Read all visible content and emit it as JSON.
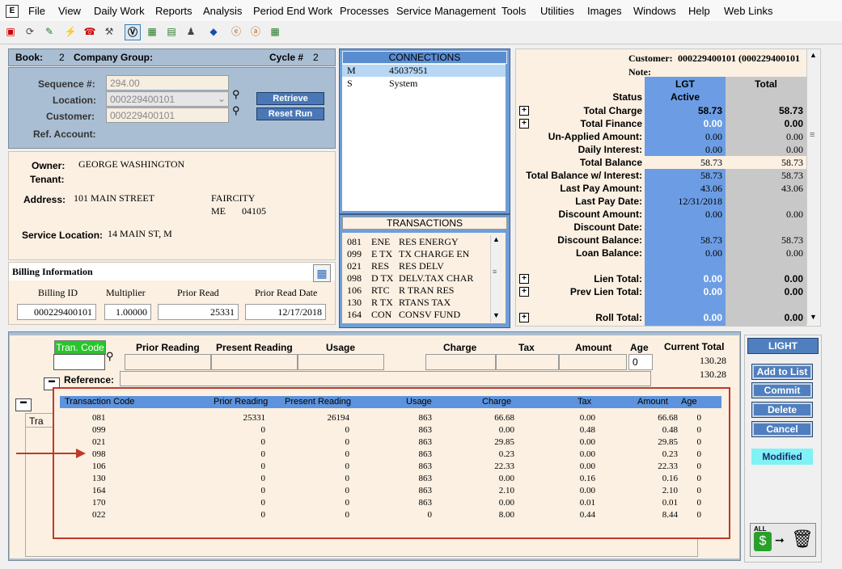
{
  "menu": [
    "File",
    "View",
    "Daily Work",
    "Reports",
    "Analysis",
    "Period End Work",
    "Processes",
    "Service Management",
    "Tools",
    "Utilities",
    "Images",
    "Windows",
    "Help",
    "Web Links"
  ],
  "app_icon_letter": "E",
  "header": {
    "book_label": "Book:",
    "book_value": "2",
    "company_group_label": "Company Group:",
    "cycle_label": "Cycle #",
    "cycle_value": "2"
  },
  "lookup": {
    "sequence_label": "Sequence #:",
    "sequence_value": "294.00",
    "location_label": "Location:",
    "location_value": "000229400101",
    "customer_label": "Customer:",
    "customer_value": "000229400101",
    "ref_account_label": "Ref. Account:",
    "retrieve_label": "Retrieve",
    "reset_run_label": "Reset Run"
  },
  "owner": {
    "owner_label": "Owner:",
    "owner_value": "GEORGE WASHINGTON",
    "tenant_label": "Tenant:",
    "address_label": "Address:",
    "address_value": "101 MAIN STREET",
    "city": "FAIRCITY",
    "state": "ME",
    "zip": "04105",
    "service_location_label": "Service Location:",
    "service_location_value": "14 MAIN ST, M"
  },
  "billing": {
    "title": "Billing Information",
    "billing_id_label": "Billing ID",
    "billing_id_value": "000229400101",
    "multiplier_label": "Multiplier",
    "multiplier_value": "1.00000",
    "prior_read_label": "Prior Read",
    "prior_read_value": "25331",
    "prior_read_date_label": "Prior Read Date",
    "prior_read_date_value": "12/17/2018"
  },
  "connections": {
    "title": "CONNECTIONS",
    "rows": [
      {
        "code": "M",
        "value": "45037951"
      },
      {
        "code": "S",
        "value": "System"
      }
    ]
  },
  "transactions": {
    "title": "TRANSACTIONS",
    "rows": [
      {
        "num": "081",
        "code": "ENE",
        "desc": "RES ENERGY"
      },
      {
        "num": "099",
        "code": "E TX",
        "desc": "TX CHARGE EN"
      },
      {
        "num": "021",
        "code": "RES",
        "desc": "RES DELV"
      },
      {
        "num": "098",
        "code": "D TX",
        "desc": "DELV.TAX CHAR"
      },
      {
        "num": "106",
        "code": "RTC",
        "desc": "R TRAN RES"
      },
      {
        "num": "130",
        "code": "R TX",
        "desc": "RTANS TAX"
      },
      {
        "num": "164",
        "code": "CON",
        "desc": "CONSV FUND"
      }
    ]
  },
  "account": {
    "customer_label": "Customer:",
    "customer_value": "000229400101 (000229400101",
    "note_label": "Note:",
    "col1_header": "LGT",
    "col2_header": "Total",
    "status_label": "Status",
    "status_value": "Active",
    "rows": [
      {
        "label": "Total Charge",
        "lgt": "58.73",
        "total": "58.73",
        "plus": true,
        "bold": true
      },
      {
        "label": "Total Finance",
        "lgt": "0.00",
        "total": "0.00",
        "plus": true,
        "bold": true
      },
      {
        "label": "Un-Applied Amount:",
        "lgt": "0.00",
        "total": "0.00",
        "plus": false,
        "bold": false
      },
      {
        "label": "Daily Interest:",
        "lgt": "0.00",
        "total": "0.00",
        "plus": false,
        "bold": false
      },
      {
        "label": "Total Balance",
        "lgt": "58.73",
        "total": "58.73",
        "plus": false,
        "bold": false,
        "cream": true
      },
      {
        "label": "Total Balance w/ Interest:",
        "lgt": "58.73",
        "total": "58.73",
        "plus": false,
        "bold": false
      },
      {
        "label": "Last Pay Amount:",
        "lgt": "43.06",
        "total": "43.06",
        "plus": false,
        "bold": false
      },
      {
        "label": "Last Pay Date:",
        "lgt": "12/31/2018",
        "total": "",
        "plus": false,
        "bold": false
      },
      {
        "label": "Discount Amount:",
        "lgt": "0.00",
        "total": "0.00",
        "plus": false,
        "bold": false
      },
      {
        "label": "Discount Date:",
        "lgt": "",
        "total": "",
        "plus": false,
        "bold": false
      },
      {
        "label": "Discount Balance:",
        "lgt": "58.73",
        "total": "58.73",
        "plus": false,
        "bold": false
      },
      {
        "label": "Loan Balance:",
        "lgt": "0.00",
        "total": "0.00",
        "plus": false,
        "bold": false
      },
      {
        "label": "",
        "lgt": "",
        "total": "",
        "plus": false,
        "bold": false
      },
      {
        "label": "Lien Total:",
        "lgt": "0.00",
        "total": "0.00",
        "plus": true,
        "bold": true
      },
      {
        "label": "Prev Lien Total:",
        "lgt": "0.00",
        "total": "0.00",
        "plus": true,
        "bold": true
      },
      {
        "label": "",
        "lgt": "",
        "total": "",
        "plus": false,
        "bold": false
      },
      {
        "label": "Roll Total:",
        "lgt": "0.00",
        "total": "0.00",
        "plus": true,
        "bold": true
      }
    ]
  },
  "entry": {
    "tran_code_label": "Tran. Code",
    "prior_reading_label": "Prior Reading",
    "present_reading_label": "Present Reading",
    "usage_label": "Usage",
    "charge_label": "Charge",
    "tax_label": "Tax",
    "amount_label": "Amount",
    "age_label": "Age",
    "age_value": "0",
    "current_total_label": "Current Total",
    "current_total_1": "130.28",
    "current_total_2": "130.28",
    "reference_label": "Reference:",
    "partial_tab_label": "Tra"
  },
  "grid": {
    "headers": [
      "Transaction Code",
      "Prior Reading",
      "Present Reading",
      "Usage",
      "Charge",
      "Tax",
      "Amount",
      "Age"
    ],
    "rows": [
      [
        "081",
        "25331",
        "26194",
        "863",
        "66.68",
        "0.00",
        "66.68",
        "0"
      ],
      [
        "099",
        "0",
        "0",
        "863",
        "0.00",
        "0.48",
        "0.48",
        "0"
      ],
      [
        "021",
        "0",
        "0",
        "863",
        "29.85",
        "0.00",
        "29.85",
        "0"
      ],
      [
        "098",
        "0",
        "0",
        "863",
        "0.23",
        "0.00",
        "0.23",
        "0"
      ],
      [
        "106",
        "0",
        "0",
        "863",
        "22.33",
        "0.00",
        "22.33",
        "0"
      ],
      [
        "130",
        "0",
        "0",
        "863",
        "0.00",
        "0.16",
        "0.16",
        "0"
      ],
      [
        "164",
        "0",
        "0",
        "863",
        "2.10",
        "0.00",
        "2.10",
        "0"
      ],
      [
        "170",
        "0",
        "0",
        "863",
        "0.00",
        "0.01",
        "0.01",
        "0"
      ],
      [
        "022",
        "0",
        "0",
        "0",
        "8.00",
        "0.44",
        "8.44",
        "0"
      ]
    ]
  },
  "side": {
    "service_label": "LIGHT",
    "add_to_list": "Add to List",
    "commit": "Commit",
    "delete": "Delete",
    "cancel": "Cancel",
    "modified": "Modified",
    "all_label": "ALL"
  },
  "colors": {
    "panel_blue": "#a9bed3",
    "cream": "#fbf0e2",
    "lgt_column": "#6c9de4",
    "total_column": "#c8c8c8",
    "annotation_red": "#c0392b",
    "green_label": "#27c62a",
    "modified_bg": "#7ff2f5"
  }
}
